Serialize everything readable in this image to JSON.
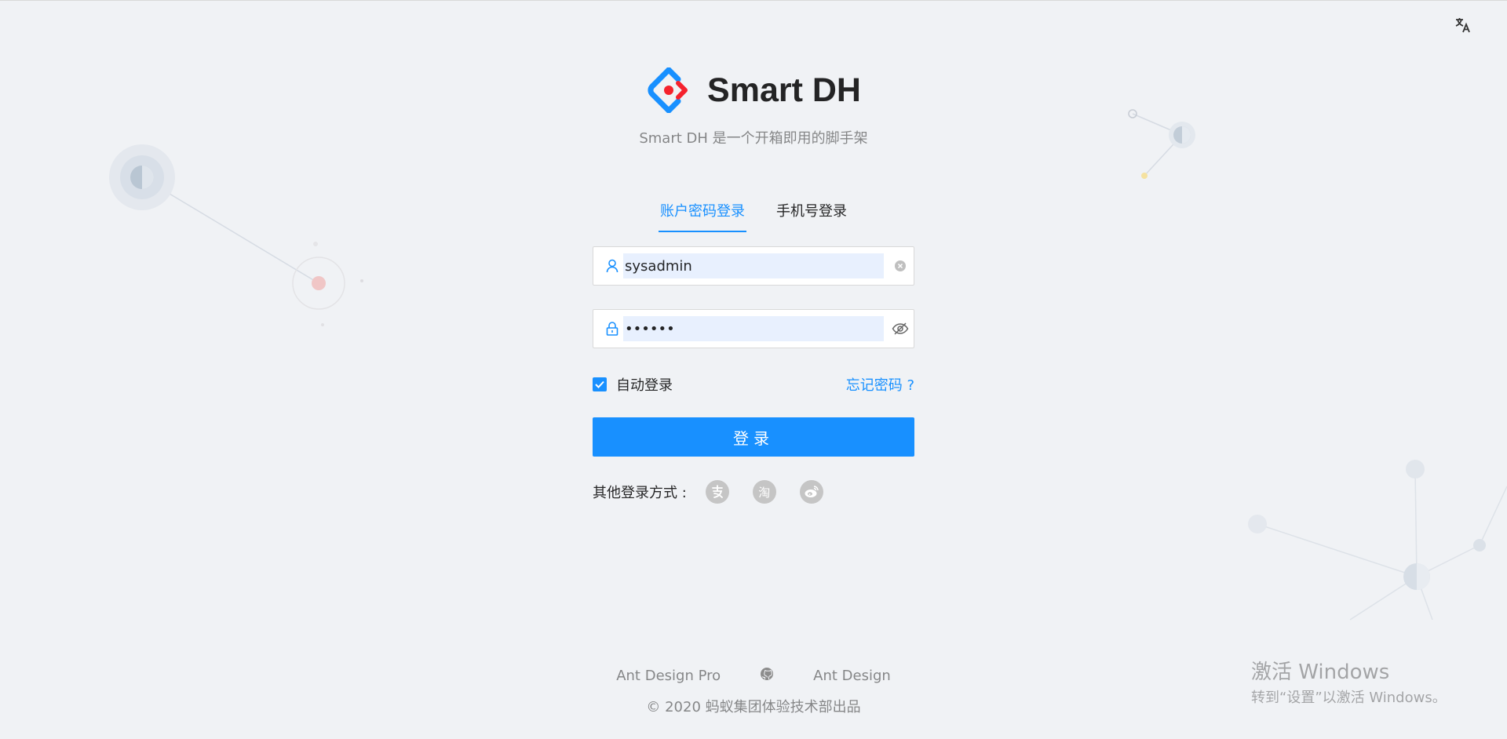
{
  "header": {
    "title": "Smart DH",
    "subtitle": "Smart DH 是一个开箱即用的脚手架"
  },
  "tabs": [
    {
      "label": "账户密码登录",
      "active": true
    },
    {
      "label": "手机号登录",
      "active": false
    }
  ],
  "form": {
    "username_value": "sysadmin",
    "password_value": "••••••",
    "remember_label": "自动登录",
    "remember_checked": true,
    "forgot_label": "忘记密码 ?",
    "submit_label": "登录"
  },
  "other_login": {
    "label": "其他登录方式 :",
    "icons": [
      "alipay-icon",
      "taobao-icon",
      "weibo-icon"
    ],
    "taobao_glyph": "淘"
  },
  "footer": {
    "links": [
      "Ant Design Pro",
      "Ant Design"
    ],
    "copyright": "© 2020 蚂蚁集团体验技术部出品"
  },
  "watermark": {
    "line1": "激活 Windows",
    "line2": "转到“设置”以激活 Windows。"
  },
  "colors": {
    "primary": "#1890ff",
    "background": "#f0f2f5",
    "autofill": "#e8f0fe",
    "social_icon": "#c5c5c5"
  }
}
